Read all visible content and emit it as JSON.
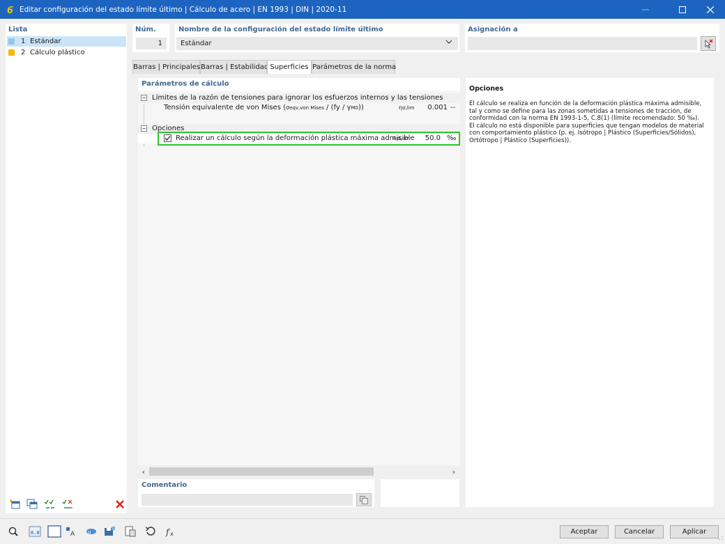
{
  "window": {
    "title": "Editar configuración del estado límite último | Cálculo de acero | EN 1993 | DIN | 2020-11"
  },
  "lista": {
    "header": "Lista",
    "items": [
      {
        "num": "1",
        "label": "Estándar",
        "color": "#8fc8ef"
      },
      {
        "num": "2",
        "label": "Cálculo plástico",
        "color": "#f5b800"
      }
    ]
  },
  "fields": {
    "num_label": "Núm.",
    "num_value": "1",
    "name_label": "Nombre de la configuración del estado límite último",
    "name_value": "Estándar",
    "asig_label": "Asignación a"
  },
  "tabs": [
    "Barras | Principales",
    "Barras | Estabilidad",
    "Superficies",
    "Parámetros de la norma"
  ],
  "active_tab": "Superficies",
  "params": {
    "header": "Parámetros de cálculo",
    "group1": "Límites de la razón de tensiones para ignorar los esfuerzos internos y las tensiones",
    "row1_label": "Tensión equivalente de von Mises (",
    "row1_sigma": "σ",
    "row1_sigma_sub": "eqv,von Mises",
    "row1_mid": " / (f",
    "row1_fy_sub": "y",
    "row1_gamma": " / γ",
    "row1_gamma_sub": "M0",
    "row1_end": "))",
    "row1_symbol": "η",
    "row1_symbol_sub": "σ,lim",
    "row1_value": "0.001",
    "row1_unit": "--",
    "group2": "Opciones",
    "row2_label": "Realizar un cálculo según la deformación plástica máxima admisible",
    "row2_symbol": "ε",
    "row2_symbol_sub": "pl,lim",
    "row2_value": "50.0",
    "row2_unit": "‰",
    "row2_checked": true
  },
  "opciones": {
    "title": "Opciones",
    "lines": [
      "El cálculo se realiza en función de la deformación plástica máxima admisible,",
      "tal y como se define para las zonas sometidas a tensiones de tracción, de",
      "conformidad con la norma EN 1993-1-5, C.8(1) (límite recomendado: 50 ‰).",
      "El cálculo no está disponible para superficies que tengan modelos de material",
      "con comportamiento plástico (p. ej. Isótropo | Plástico (Superficies/Sólidos),",
      "Ortótropo | Plástico (Superficies))."
    ]
  },
  "comentario": {
    "label": "Comentario"
  },
  "buttons": {
    "accept": "Aceptar",
    "cancel": "Cancelar",
    "apply": "Aplicar"
  },
  "colors": {
    "accent": "#1d64c0",
    "header": "#41688f",
    "highlight": "#2ec52e"
  }
}
